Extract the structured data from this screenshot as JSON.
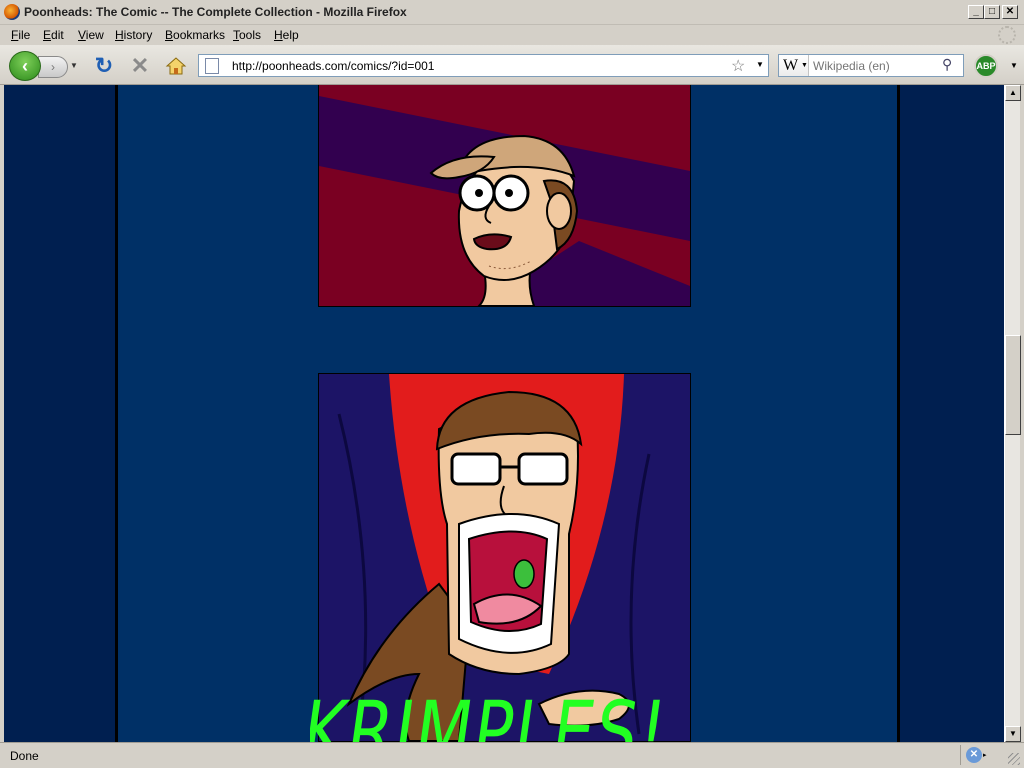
{
  "window": {
    "title": "Poonheads: The Comic -- The Complete Collection - Mozilla Firefox",
    "controls": {
      "minimize": "_",
      "maximize": "□",
      "close": "✕"
    }
  },
  "menu": {
    "items": [
      "File",
      "Edit",
      "View",
      "History",
      "Bookmarks",
      "Tools",
      "Help"
    ]
  },
  "toolbar": {
    "back_icon": "‹",
    "forward_icon": "›",
    "reload_icon": "↻",
    "stop_icon": "✕",
    "url": "http://poonheads.com/comics/?id=001",
    "bookmark_star": "☆",
    "search_engine": "W",
    "search_placeholder": "Wikipedia (en)",
    "search_go": "⚲",
    "abp_label": "ABP"
  },
  "comic": {
    "panel2_caption": "KRIMPLES!"
  },
  "status": {
    "text": "Done",
    "addon_glyph": "✕"
  },
  "colors": {
    "page_bg": "#003066",
    "side_bg": "#001f50",
    "panel1_red": "#7a0022",
    "panel1_purple": "#32004f",
    "panel2_blue": "#1c1466",
    "panel2_red": "#e21c1c",
    "caption_green": "#22ff22"
  }
}
